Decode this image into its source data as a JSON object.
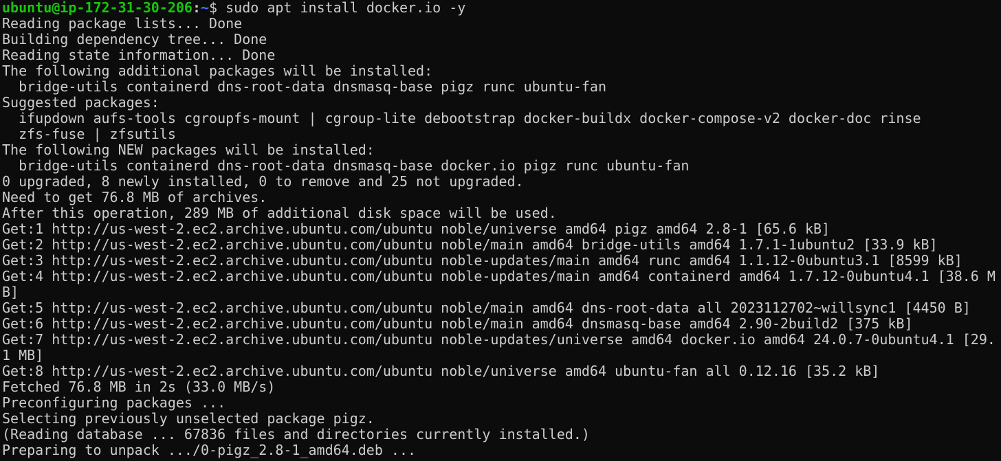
{
  "terminal": {
    "prompt": {
      "user_host": "ubuntu@ip-172-31-30-206",
      "separator": ":",
      "path": "~",
      "symbol": "$ ",
      "command": "sudo apt install docker.io -y",
      "colors": {
        "user_host": "#16c60c",
        "path": "#3b78ff",
        "text": "#cccccc",
        "background": "#0c0c0c"
      }
    },
    "lines": [
      "Reading package lists... Done",
      "Building dependency tree... Done",
      "Reading state information... Done",
      "The following additional packages will be installed:",
      "  bridge-utils containerd dns-root-data dnsmasq-base pigz runc ubuntu-fan",
      "Suggested packages:",
      "  ifupdown aufs-tools cgroupfs-mount | cgroup-lite debootstrap docker-buildx docker-compose-v2 docker-doc rinse",
      "  zfs-fuse | zfsutils",
      "The following NEW packages will be installed:",
      "  bridge-utils containerd dns-root-data dnsmasq-base docker.io pigz runc ubuntu-fan",
      "0 upgraded, 8 newly installed, 0 to remove and 25 not upgraded.",
      "Need to get 76.8 MB of archives.",
      "After this operation, 289 MB of additional disk space will be used.",
      "Get:1 http://us-west-2.ec2.archive.ubuntu.com/ubuntu noble/universe amd64 pigz amd64 2.8-1 [65.6 kB]",
      "Get:2 http://us-west-2.ec2.archive.ubuntu.com/ubuntu noble/main amd64 bridge-utils amd64 1.7.1-1ubuntu2 [33.9 kB]",
      "Get:3 http://us-west-2.ec2.archive.ubuntu.com/ubuntu noble-updates/main amd64 runc amd64 1.1.12-0ubuntu3.1 [8599 kB]",
      "Get:4 http://us-west-2.ec2.archive.ubuntu.com/ubuntu noble-updates/main amd64 containerd amd64 1.7.12-0ubuntu4.1 [38.6 M",
      "B]",
      "Get:5 http://us-west-2.ec2.archive.ubuntu.com/ubuntu noble/main amd64 dns-root-data all 2023112702~willsync1 [4450 B]",
      "Get:6 http://us-west-2.ec2.archive.ubuntu.com/ubuntu noble/main amd64 dnsmasq-base amd64 2.90-2build2 [375 kB]",
      "Get:7 http://us-west-2.ec2.archive.ubuntu.com/ubuntu noble-updates/universe amd64 docker.io amd64 24.0.7-0ubuntu4.1 [29.",
      "1 MB]",
      "Get:8 http://us-west-2.ec2.archive.ubuntu.com/ubuntu noble/universe amd64 ubuntu-fan all 0.12.16 [35.2 kB]",
      "Fetched 76.8 MB in 2s (33.0 MB/s)",
      "Preconfiguring packages ...",
      "Selecting previously unselected package pigz.",
      "(Reading database ... 67836 files and directories currently installed.)",
      "Preparing to unpack .../0-pigz_2.8-1_amd64.deb ..."
    ]
  }
}
